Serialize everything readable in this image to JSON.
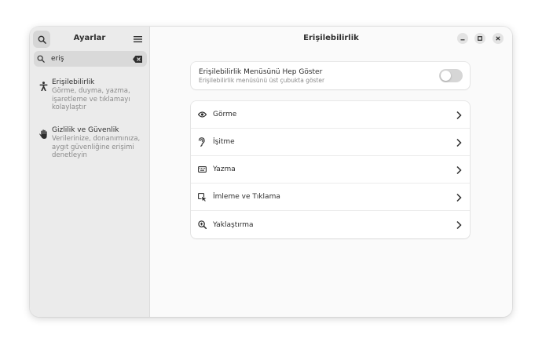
{
  "sidebar": {
    "title": "Ayarlar",
    "search": {
      "value": "eriş",
      "placeholder": ""
    },
    "results": [
      {
        "title": "Erişilebilirlik",
        "description": "Görme, duyma, yazma, işaretleme ve tıklamayı kolaylaştır",
        "icon": "accessibility-icon"
      },
      {
        "title": "Gizlilik ve Güvenlik",
        "description": "Verilerinize, donanımınıza, aygıt güvenliğine erişimi denetleyin",
        "icon": "hand-icon"
      }
    ]
  },
  "main": {
    "title": "Erişilebilirlik",
    "toggle": {
      "title": "Erişilebilirlik Menüsünü Hep Göster",
      "subtitle": "Erişilebilirlik menüsünü üst çubukta göster",
      "on": false
    },
    "items": [
      {
        "label": "Görme",
        "icon": "eye-icon"
      },
      {
        "label": "İşitme",
        "icon": "ear-icon"
      },
      {
        "label": "Yazma",
        "icon": "keyboard-icon"
      },
      {
        "label": "İmleme ve Tıklama",
        "icon": "pointer-click-icon"
      },
      {
        "label": "Yaklaştırma",
        "icon": "zoom-in-icon"
      }
    ]
  },
  "colors": {
    "sidebar_bg": "#ebebeb",
    "content_bg": "#fafafa",
    "card_bg": "#ffffff",
    "switch_off": "#d6d6d6"
  }
}
